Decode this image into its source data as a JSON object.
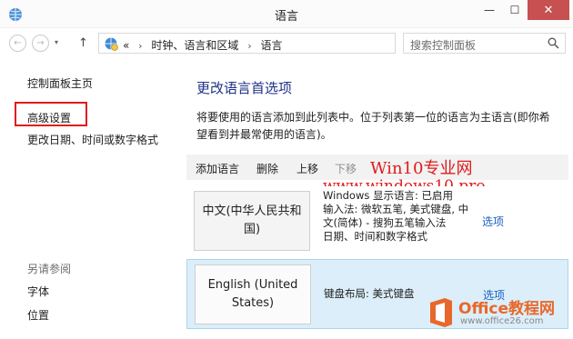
{
  "window": {
    "title": "语言",
    "min": "—",
    "max": "☐",
    "close": "✕"
  },
  "nav": {
    "back": "←",
    "forward": "→",
    "up": "↑",
    "address_prefix": "«",
    "breadcrumb": [
      "时钟、语言和区域",
      "语言"
    ],
    "separator": "›",
    "search_placeholder": "搜索控制面板"
  },
  "left": {
    "home": "控制面板主页",
    "advanced": "高级设置",
    "date_format": "更改日期、时间或数字格式",
    "see_also": "另请参阅",
    "fonts": "字体",
    "location": "位置"
  },
  "main": {
    "title": "更改语言首选项",
    "description": "将要使用的语言添加到此列表中。位于列表第一位的语言为主语言(即你希望看到并最常使用的语言)。",
    "toolbar": {
      "add": "添加语言",
      "delete": "删除",
      "up": "上移",
      "down": "下移"
    },
    "languages": [
      {
        "name": "中文(中华人民共和国)",
        "info": [
          "Windows 显示语言: 已启用",
          "输入法: 微软五笔, 美式键盘, 中文(简体) - 搜狗五笔输入法",
          "日期、时间和数字格式"
        ],
        "options": "选项"
      },
      {
        "name": "English (United States)",
        "info": [
          "键盘布局: 美式键盘"
        ],
        "options": "选项"
      }
    ]
  },
  "watermarks": {
    "line1": "Win10专业网",
    "line2": "www.windows10.pro",
    "office": "Office教程网",
    "office_url": "www.office26.com"
  },
  "colors": {
    "close_button": "#c75050",
    "highlight_box": "#e01b1b",
    "link": "#1a5fbf",
    "selected_row": "#dbeef9",
    "title_blue": "#1e3287"
  }
}
